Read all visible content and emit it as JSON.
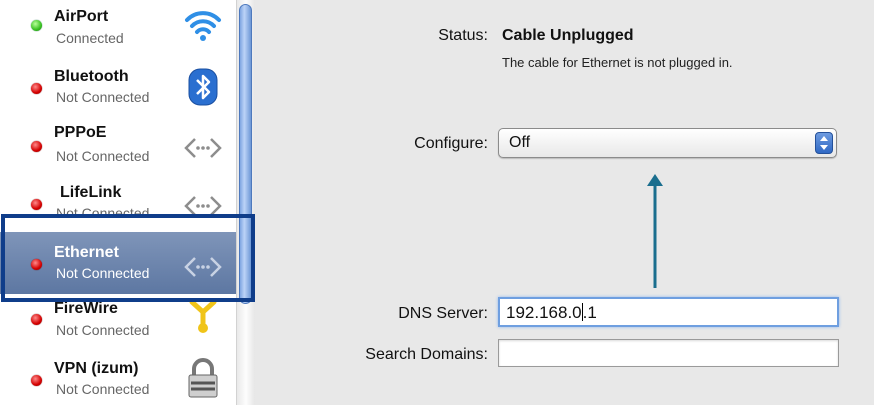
{
  "sidebar": {
    "items": [
      {
        "name": "AirPort",
        "status": "Connected",
        "state": "connected",
        "icon": "wifi-icon"
      },
      {
        "name": "Bluetooth",
        "status": "Not Connected",
        "state": "disconnected",
        "icon": "bluetooth-icon"
      },
      {
        "name": "PPPoE",
        "status": "Not Connected",
        "state": "disconnected",
        "icon": "network-arrows-icon"
      },
      {
        "name": "LifeLink",
        "status": "Not Connected",
        "state": "disconnected",
        "icon": "network-arrows-icon"
      },
      {
        "name": "Ethernet",
        "status": "Not Connected",
        "state": "disconnected",
        "icon": "network-arrows-icon",
        "selected": true
      },
      {
        "name": "FireWire",
        "status": "Not Connected",
        "state": "disconnected",
        "icon": "firewire-icon"
      },
      {
        "name": "VPN (izum)",
        "status": "Not Connected",
        "state": "disconnected",
        "icon": "lock-icon"
      }
    ]
  },
  "detail": {
    "status_label": "Status:",
    "status_value": "Cable Unplugged",
    "status_note": "The cable for Ethernet is not plugged in.",
    "configure_label": "Configure:",
    "configure_value": "Off",
    "dns_label": "DNS Server:",
    "dns_value_before": "192.168.0",
    "dns_value_after": ".1",
    "search_label": "Search Domains:",
    "search_value": ""
  },
  "colors": {
    "accent": "#1a6e8e",
    "highlight_box": "#0f3d8a",
    "selected_row": "#6b82ab"
  }
}
